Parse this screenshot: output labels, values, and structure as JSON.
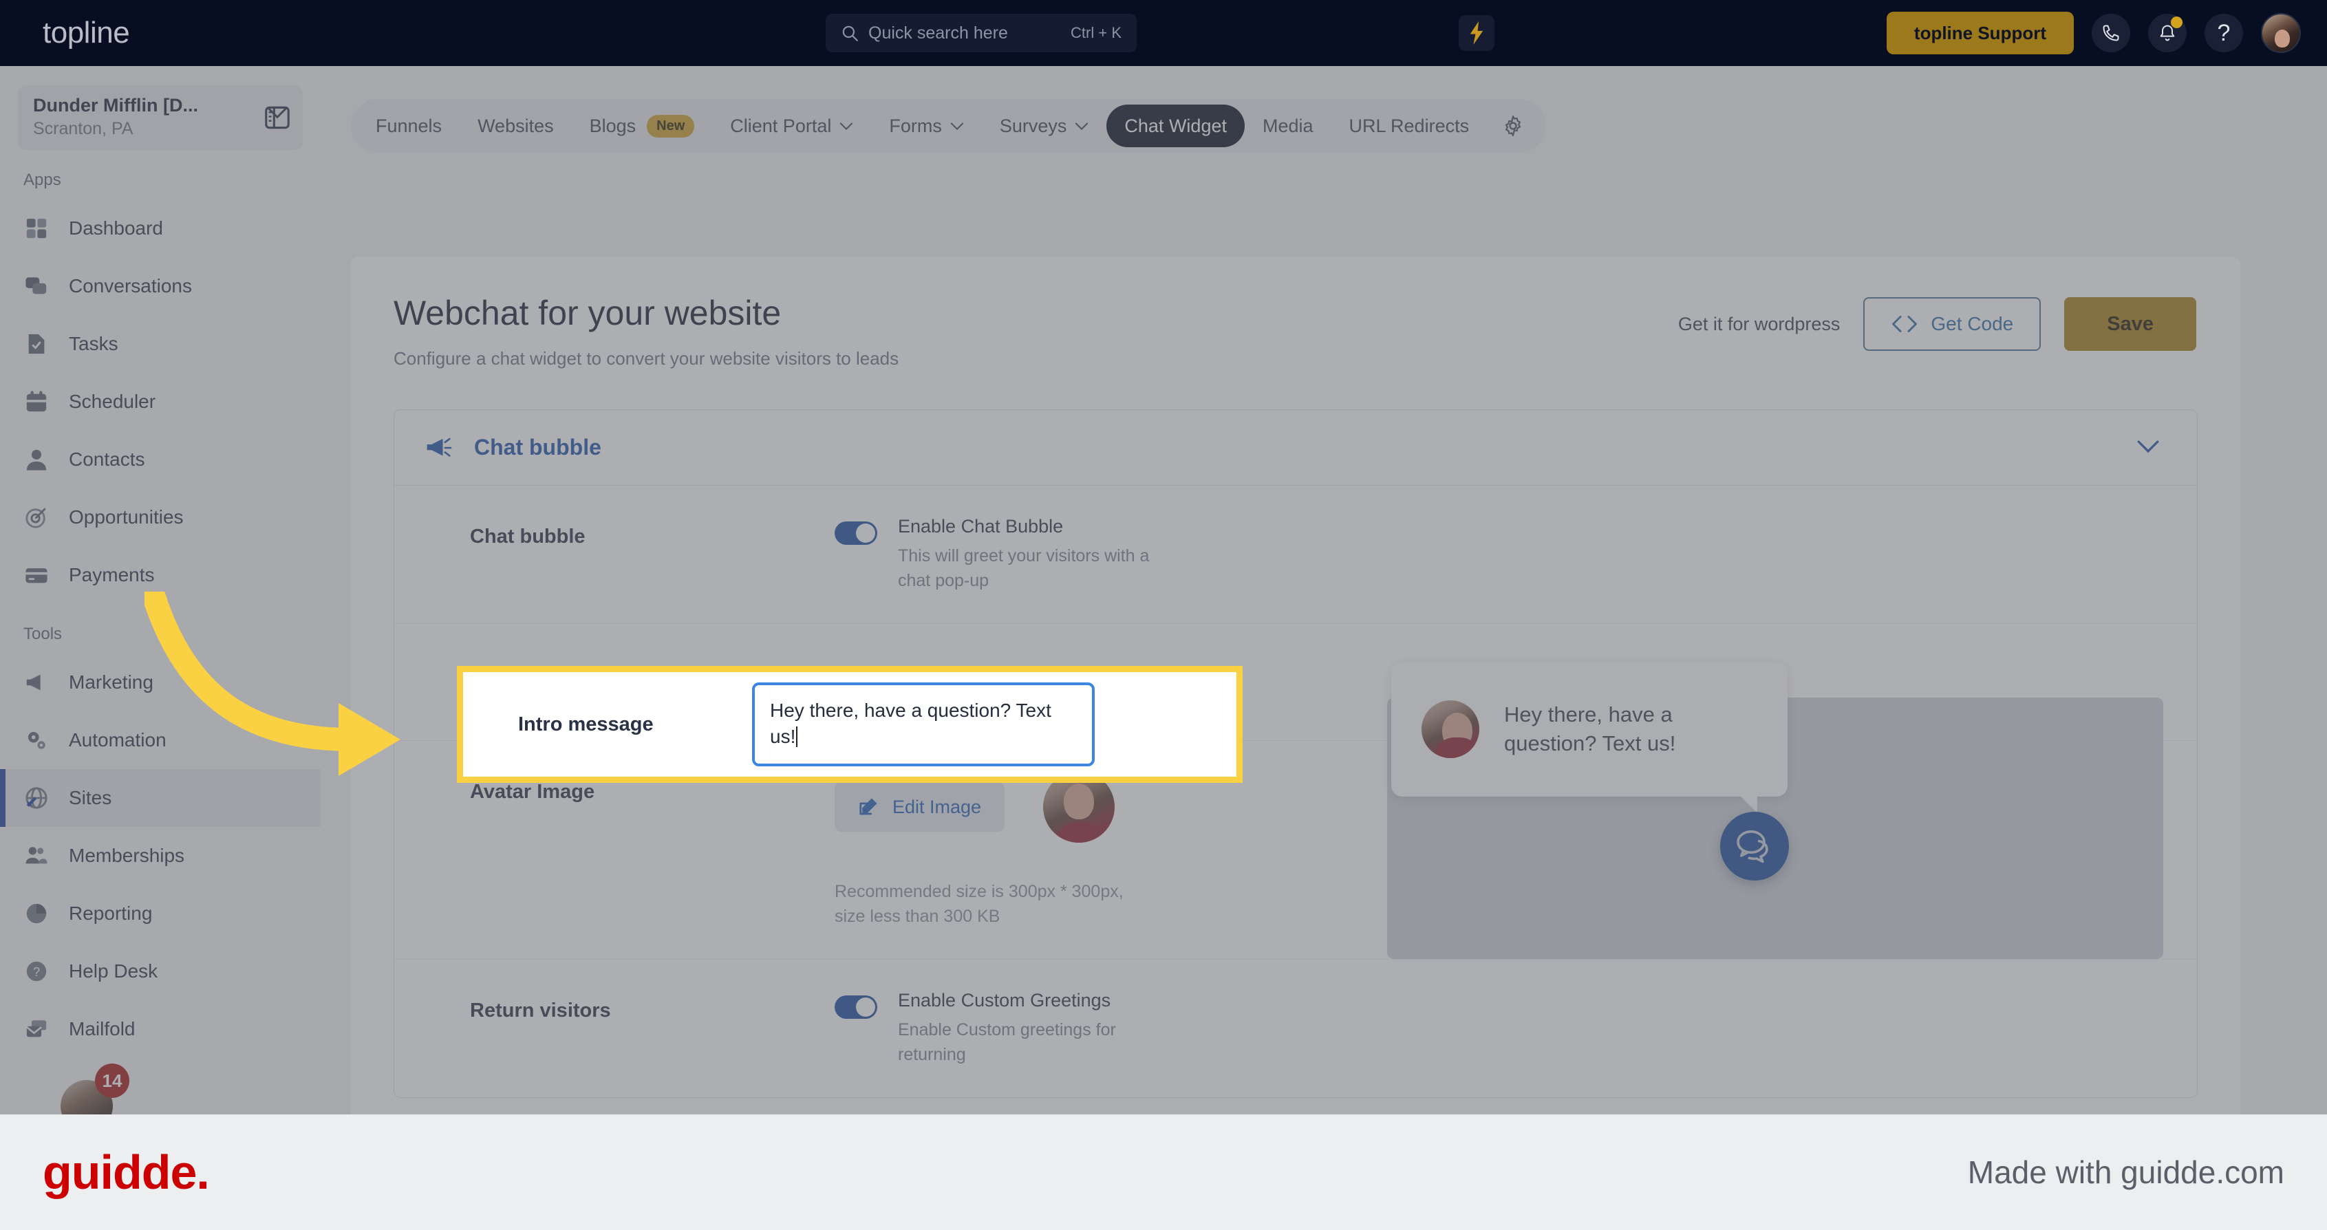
{
  "topbar": {
    "logo": "topline",
    "search": {
      "placeholder": "Quick search here",
      "shortcut": "Ctrl + K"
    },
    "bolt_icon": "lightning-bolt-icon",
    "support_button": "topline Support",
    "phone_icon": "phone-icon",
    "bell_icon": "bell-icon",
    "help_icon": "question-mark-icon",
    "avatar": "user-avatar"
  },
  "sidebar": {
    "location": {
      "name": "Dunder Mifflin [D...",
      "sub": "Scranton, PA"
    },
    "panel_toggle_icon": "panel-toggle-icon",
    "sections": [
      {
        "label": "Apps",
        "items": [
          {
            "label": "Dashboard",
            "icon": "dashboard-icon"
          },
          {
            "label": "Conversations",
            "icon": "chat-icon"
          },
          {
            "label": "Tasks",
            "icon": "task-icon"
          },
          {
            "label": "Scheduler",
            "icon": "calendar-icon"
          },
          {
            "label": "Contacts",
            "icon": "person-icon"
          },
          {
            "label": "Opportunities",
            "icon": "target-icon"
          },
          {
            "label": "Payments",
            "icon": "credit-card-icon"
          }
        ]
      },
      {
        "label": "Tools",
        "items": [
          {
            "label": "Marketing",
            "icon": "megaphone-icon"
          },
          {
            "label": "Automation",
            "icon": "gears-icon"
          },
          {
            "label": "Sites",
            "icon": "globe-icon",
            "active": true
          },
          {
            "label": "Memberships",
            "icon": "people-icon"
          },
          {
            "label": "Reporting",
            "icon": "pie-chart-icon"
          },
          {
            "label": "Help Desk",
            "icon": "question-circle-icon"
          },
          {
            "label": "Mailfold",
            "icon": "mail-icon"
          }
        ]
      }
    ],
    "badge_count": "14"
  },
  "nav_tabs": [
    {
      "label": "Funnels"
    },
    {
      "label": "Websites"
    },
    {
      "label": "Blogs",
      "badge": "New"
    },
    {
      "label": "Client Portal",
      "caret": true
    },
    {
      "label": "Forms",
      "caret": true
    },
    {
      "label": "Surveys",
      "caret": true
    },
    {
      "label": "Chat Widget",
      "active": true
    },
    {
      "label": "Media"
    },
    {
      "label": "URL Redirects"
    },
    {
      "label": "",
      "icon": "gear-icon"
    }
  ],
  "page": {
    "title": "Webchat for your website",
    "subtitle": "Configure a chat widget to convert your website visitors to leads",
    "wordpress_link": "Get it for wordpress",
    "get_code_button": "Get Code",
    "get_code_icon": "code-brackets-icon",
    "save_button": "Save"
  },
  "section": {
    "icon": "megaphone-icon",
    "title": "Chat bubble",
    "collapse_icon": "chevron-down-icon",
    "rows": {
      "chat_bubble": {
        "label": "Chat bubble",
        "toggle_on": true,
        "ctl_title": "Enable Chat Bubble",
        "ctl_desc": "This will greet your visitors with a chat pop-up"
      },
      "intro_message": {
        "label": "Intro message",
        "value": "Hey there, have a question? Text us!"
      },
      "avatar_image": {
        "label": "Avatar Image",
        "edit_button": "Edit Image",
        "edit_icon": "pencil-square-icon",
        "note": "Recommended size is 300px * 300px, size less than 300 KB",
        "avatar": "agent-avatar"
      },
      "return_visitors": {
        "label": "Return visitors",
        "toggle_on": true,
        "ctl_title": "Enable Custom Greetings",
        "ctl_desc": "Enable Custom greetings for returning"
      }
    }
  },
  "preview": {
    "bubble_text": "Hey there, have a question? Text us!",
    "bubble_avatar": "agent-avatar",
    "fab_icon": "chat-bubbles-icon"
  },
  "footer": {
    "logo": "guidde.",
    "made_with": "Made with guidde.com"
  },
  "colors": {
    "topbar_bg": "#080e22",
    "accent_gold": "#a8811c",
    "accent_blue": "#2154ac",
    "highlight_yellow": "#fbd144",
    "guidde_red": "#cc0000"
  }
}
